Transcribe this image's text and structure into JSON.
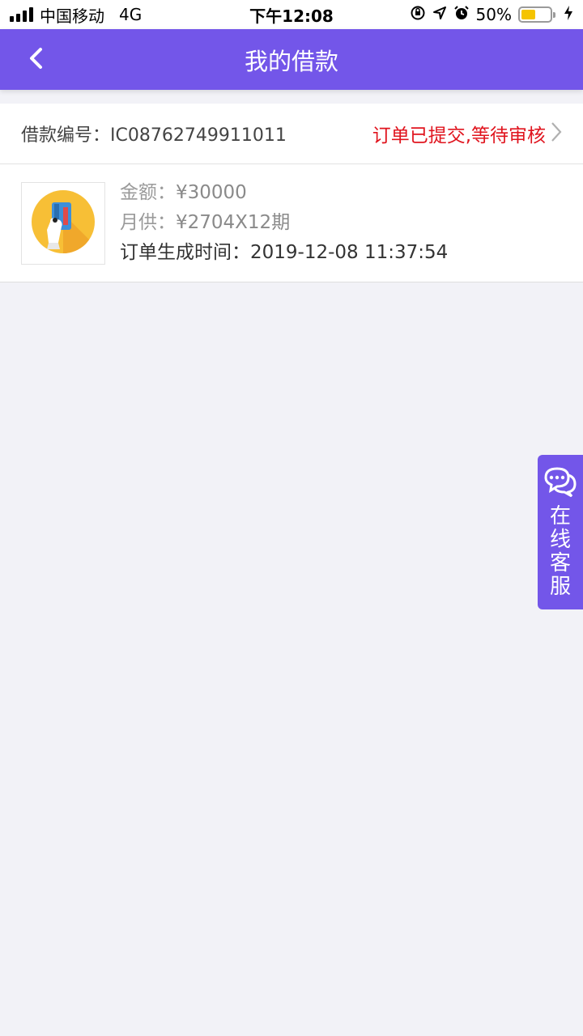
{
  "status_bar": {
    "carrier": "中国移动",
    "network": "4G",
    "time": "下午12:08",
    "battery_percent": "50%",
    "battery_level": 0.5,
    "icons": [
      "orientation-lock-icon",
      "location-arrow-icon",
      "alarm-icon",
      "charging-bolt-icon"
    ]
  },
  "nav": {
    "title": "我的借款",
    "back_icon": "chevron-left-icon"
  },
  "order": {
    "number_label": "借款编号：",
    "number": "IC08762749911011",
    "status": "订单已提交,等待审核",
    "amount_label": "金额：",
    "amount": "¥30000",
    "monthly_label": "月供：",
    "monthly": "¥2704X12期",
    "created_label": "订单生成时间：",
    "created_time": "2019-12-08 11:37:54",
    "thumbnail_icon": "card-in-hand-icon"
  },
  "service": {
    "label": "在线客服",
    "icon": "chat-bubbles-icon"
  },
  "colors": {
    "brand": "#7356e9",
    "status_red": "#e0141e",
    "background": "#f2f2f7"
  }
}
